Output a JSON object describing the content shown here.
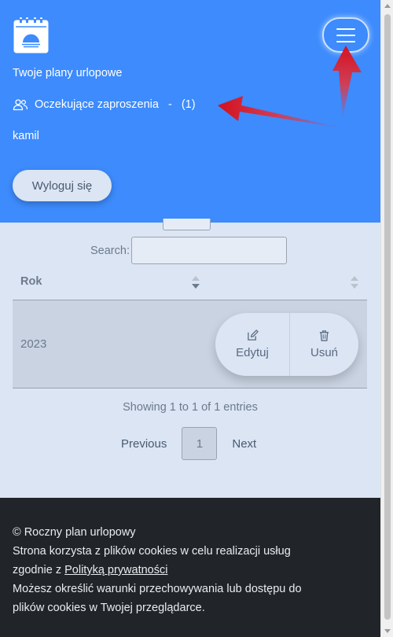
{
  "navbar": {
    "logo_icon": "calendar-sun-icon",
    "toggler_icon": "hamburger-menu-icon",
    "links": {
      "plans": "Twoje plany urlopowe",
      "invites": "Oczekujące zaproszenia",
      "invites_sep": "-",
      "invites_count": "(1)",
      "user": "kamil"
    },
    "logout_label": "Wyloguj się",
    "accent_color": "#3d8bfd"
  },
  "table_controls": {
    "search_label": "Search:",
    "search_value": ""
  },
  "table": {
    "headers": [
      "Rok",
      ""
    ],
    "rows": [
      {
        "year": "2023",
        "edit_label": "Edytuj",
        "delete_label": "Usuń"
      }
    ]
  },
  "info_text": "Showing 1 to 1 of 1 entries",
  "pagination": {
    "previous": "Previous",
    "current": "1",
    "next": "Next"
  },
  "footer": {
    "line1": "© Roczny plan urlopowy",
    "line2": "Strona korzysta z plików cookies w celu realizacji usług",
    "line3_prefix": "zgodnie z ",
    "policy_link": "Polityką prywatności",
    "line4": "Możesz określić warunki przechowywania lub dostępu do",
    "line5": "plików cookies w Twojej przeglądarce."
  }
}
